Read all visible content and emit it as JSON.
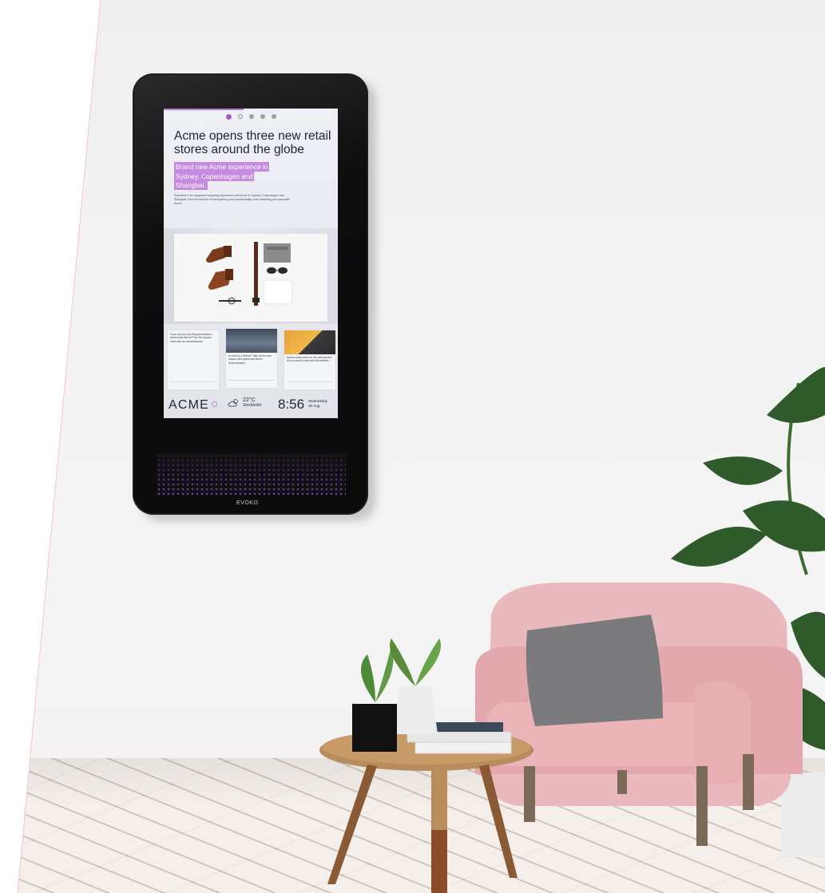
{
  "screen": {
    "headline": "Acme opens three new retail stores around the globe",
    "highlight": "Brand new Acme experience in Sydney, Copenhagen and Shanghai.",
    "body": "Experience the upgraded shopping experience with Acme in Sydney, Copenhagen and Shanghai. Feel the flourish of transparency and sustainability when selecting your favourite Acme.",
    "cards": [
      {
        "text": "If you only buy one thing this Autumn, what would that be? See the big and more with our #AcmeAutumn"
      },
      {
        "text": "In need of a refresh? Take on the new season with stylish and denim. #AcmeAutumn"
      },
      {
        "text": "Need to keep warm on the chill Autumn? All you need is here with #AcmeWest"
      }
    ],
    "footer": {
      "logo": "ACME",
      "temperature": "22°C",
      "city": "Stockholm",
      "time": "8:56",
      "weekday": "Wednesday",
      "day": "30 Aug"
    }
  },
  "device": {
    "brand": "EVOKO"
  },
  "colors": {
    "accent": "#c48be0",
    "device": "#0d0d0e",
    "armchair": "#e9b9bd"
  },
  "icons": [
    "weather-cloud-sun-icon"
  ]
}
